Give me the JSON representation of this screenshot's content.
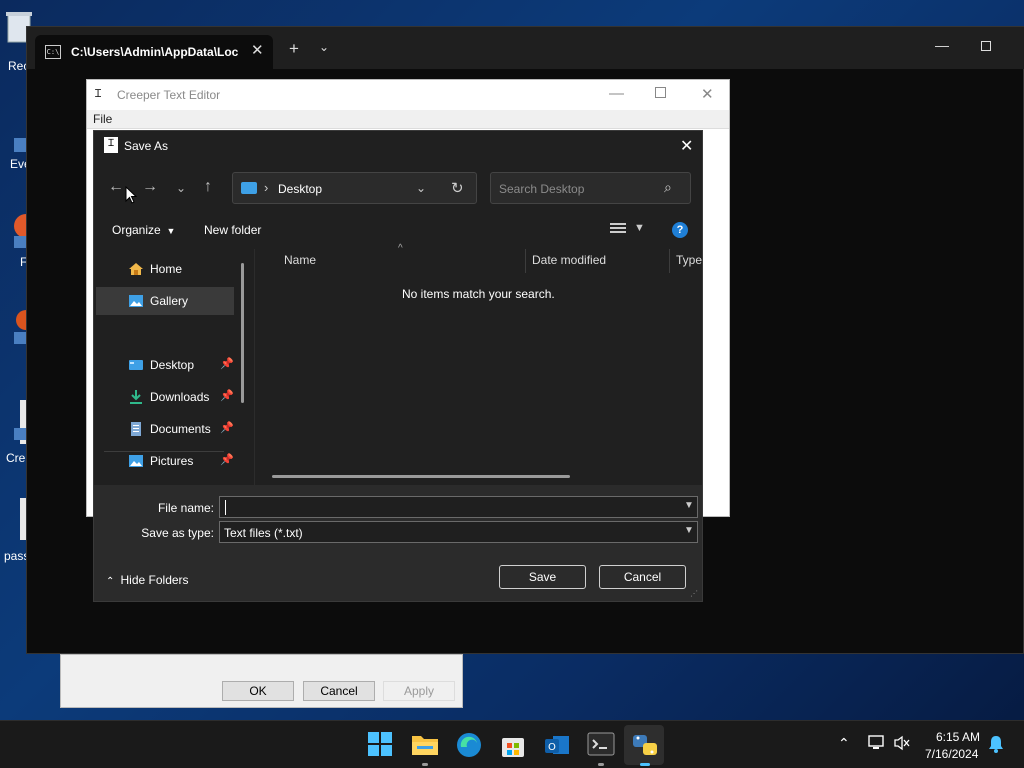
{
  "desktop": {
    "icon_labels": [
      "Rec",
      "Eve",
      "F",
      "Cre",
      "pass"
    ]
  },
  "terminal": {
    "tab_title": "C:\\Users\\Admin\\AppData\\Loc",
    "tab_icon_text": "C:\\"
  },
  "editor": {
    "title": "Creeper Text Editor",
    "menu_file": "File"
  },
  "prop_dialog": {
    "ok": "OK",
    "cancel": "Cancel",
    "apply": "Apply"
  },
  "saveas": {
    "title": "Save As",
    "address": "Desktop",
    "search_placeholder": "Search Desktop",
    "toolbar": {
      "organize": "Organize",
      "new_folder": "New folder"
    },
    "nav": [
      {
        "label": "Home",
        "pinned": false
      },
      {
        "label": "Gallery",
        "pinned": false
      },
      {
        "label": "Desktop",
        "pinned": true
      },
      {
        "label": "Downloads",
        "pinned": true
      },
      {
        "label": "Documents",
        "pinned": true
      },
      {
        "label": "Pictures",
        "pinned": true
      }
    ],
    "columns": {
      "name": "Name",
      "date_modified": "Date modified",
      "type": "Type"
    },
    "empty_message": "No items match your search.",
    "file_name_label": "File name:",
    "file_name_value": "",
    "save_type_label": "Save as type:",
    "save_type_value": "Text files (*.txt)",
    "hide_folders": "Hide Folders",
    "save_button": "Save",
    "cancel_button": "Cancel"
  },
  "taskbar": {
    "apps": [
      "start",
      "file-explorer",
      "edge",
      "store",
      "outlook",
      "terminal",
      "python"
    ],
    "time": "6:15 AM",
    "date": "7/16/2024"
  },
  "colors": {
    "dialog_bg": "#202020",
    "bottom_bg": "#2b2b2b",
    "accent": "#1f7fd6"
  }
}
